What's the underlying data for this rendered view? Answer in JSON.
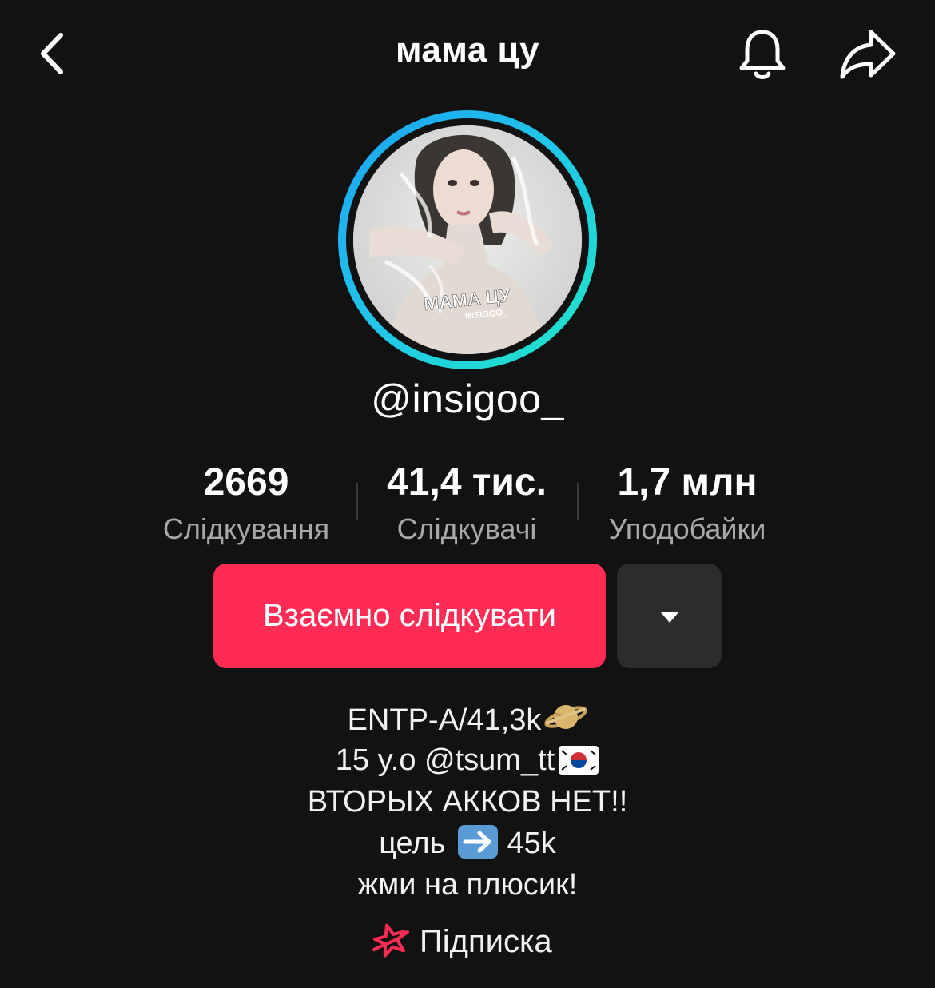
{
  "header": {
    "title": "мама цу",
    "back_icon": "chevron-left-icon",
    "notification_icon": "bell-icon",
    "share_icon": "share-arrow-icon"
  },
  "profile": {
    "avatar_text": "МАМА ЦУ",
    "avatar_subtext": "INSIGOO_",
    "handle": "@insigoo_",
    "ring_colors": [
      "#1da1f2",
      "#22e6c6"
    ]
  },
  "stats": [
    {
      "value": "2669",
      "label": "Слідкування"
    },
    {
      "value": "41,4 тис.",
      "label": "Слідкувачі"
    },
    {
      "value": "1,7 млн",
      "label": "Уподобайки"
    }
  ],
  "actions": {
    "follow_back_label": "Взаємно слідкувати",
    "more_icon": "caret-down-icon",
    "accent_color": "#fe2c55"
  },
  "bio": {
    "line1": "ENTP-A/41,3k",
    "line1_emoji": "ringed-planet-icon",
    "line2": "15 y.o @tsum_tt",
    "line2_emoji": "korea-flag-icon",
    "line3": "ВТОРЫХ АККОВ НЕТ!!",
    "line4_before": "цель",
    "line4_emoji": "right-arrow-icon",
    "line4_after": "45k",
    "line5": "жми на плюсик!"
  },
  "subscription": {
    "label": "Підписка",
    "icon": "subscription-star-icon"
  }
}
